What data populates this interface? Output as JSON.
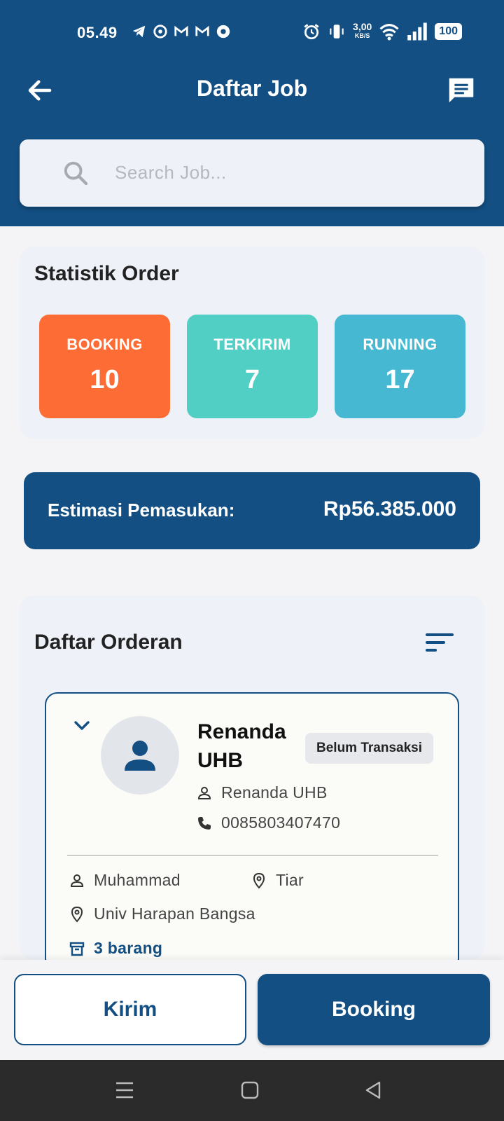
{
  "status_bar": {
    "time": "05.49",
    "speed_value": "3,00",
    "speed_unit": "KB/S",
    "battery": "100"
  },
  "header": {
    "title": "Daftar Job"
  },
  "search": {
    "placeholder": "Search Job..."
  },
  "stats": {
    "title": "Statistik Order",
    "items": [
      {
        "label": "BOOKING",
        "value": "10",
        "color": "#fe6c35"
      },
      {
        "label": "TERKIRIM",
        "value": "7",
        "color": "#52cfc4"
      },
      {
        "label": "RUNNING",
        "value": "17",
        "color": "#46b8d2"
      }
    ]
  },
  "income": {
    "label": "Estimasi Pemasukan:",
    "value": "Rp56.385.000"
  },
  "orders": {
    "title": "Daftar Orderan",
    "list": [
      {
        "customer_name": "Renanda UHB",
        "status_badge": "Belum Transaksi",
        "contact_name": "Renanda UHB",
        "phone": "0085803407470",
        "driver": "Muhammad",
        "destination": "Tiar",
        "address": "Univ Harapan Bangsa",
        "items": "3 barang"
      }
    ]
  },
  "actions": {
    "send_label": "Kirim",
    "booking_label": "Booking"
  },
  "colors": {
    "primary": "#134f83",
    "card_bg": "#eff1f9"
  }
}
